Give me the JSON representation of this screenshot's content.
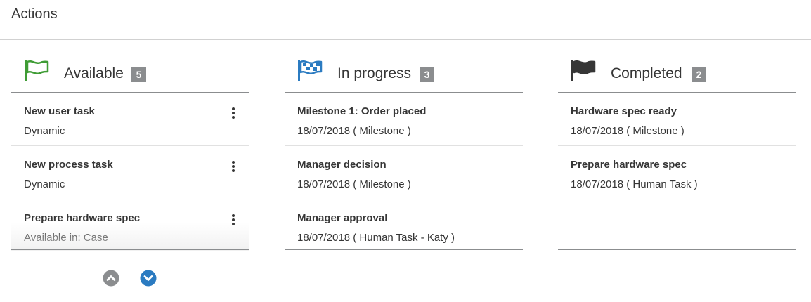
{
  "header": {
    "title": "Actions"
  },
  "columns": {
    "available": {
      "title": "Available",
      "count": "5",
      "flag_color": "#3f9c35",
      "items": [
        {
          "name": "New user task",
          "desc": "Dynamic"
        },
        {
          "name": "New process task",
          "desc": "Dynamic"
        },
        {
          "name": "Prepare hardware spec",
          "desc": "Available in: Case"
        }
      ]
    },
    "inprogress": {
      "title": "In progress",
      "count": "3",
      "flag_color": "#2b7bc1",
      "items": [
        {
          "name": "Milestone 1: Order placed",
          "desc": "18/07/2018 ( Milestone )"
        },
        {
          "name": "Manager decision",
          "desc": "18/07/2018 ( Milestone )"
        },
        {
          "name": "Manager approval",
          "desc": "18/07/2018 ( Human Task - Katy )"
        }
      ]
    },
    "completed": {
      "title": "Completed",
      "count": "2",
      "flag_color": "#363636",
      "items": [
        {
          "name": "Hardware spec ready",
          "desc": "18/07/2018 ( Milestone )"
        },
        {
          "name": "Prepare hardware spec",
          "desc": "18/07/2018 ( Human Task )"
        }
      ]
    }
  },
  "pager": {
    "up_icon": "chevron-circle-up-icon",
    "down_icon": "chevron-circle-down-icon",
    "up_color": "#8b8d8f",
    "down_color": "#2b7bc1"
  }
}
